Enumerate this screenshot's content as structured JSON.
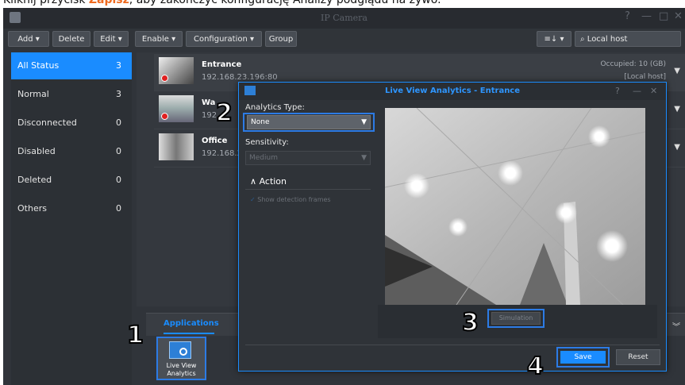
{
  "caption": {
    "prefix": "Kliknij przycisk ",
    "keyword": "Zapisz",
    "suffix": ", aby zakończyć konfigurację Analizy podglądu na żywo."
  },
  "window": {
    "title": "IP Camera",
    "help": "?",
    "minimize": "—",
    "maximize": "□",
    "close": "✕"
  },
  "toolbar": {
    "add": "Add ▾",
    "delete": "Delete",
    "edit": "Edit ▾",
    "enable": "Enable ▾",
    "configuration": "Configuration ▾",
    "group": "Group",
    "sort": "≡↓ ▾",
    "search_placeholder": "Local host"
  },
  "sidebar": {
    "items": [
      {
        "label": "All Status",
        "count": "3"
      },
      {
        "label": "Normal",
        "count": "3"
      },
      {
        "label": "Disconnected",
        "count": "0"
      },
      {
        "label": "Disabled",
        "count": "0"
      },
      {
        "label": "Deleted",
        "count": "0"
      },
      {
        "label": "Others",
        "count": "0"
      }
    ]
  },
  "cameras": [
    {
      "name": "Entrance",
      "ip": "192.168.23.196:80",
      "occupied": "Occupied: 10 (GB)",
      "host": "[Local host]"
    },
    {
      "name": "Wa",
      "ip": "192"
    },
    {
      "name": "Office",
      "ip": "192.168.2"
    }
  ],
  "applications": {
    "tab": "Applications",
    "tile_label": "Live View Analytics"
  },
  "dialog": {
    "title": "Live View Analytics - Entrance",
    "help": "?",
    "minimize": "—",
    "close": "✕",
    "analytics_type_label": "Analytics Type:",
    "analytics_type_value": "None",
    "sensitivity_label": "Sensitivity:",
    "sensitivity_value": "Medium",
    "action_label": "Action",
    "show_frames_label": "Show detection frames",
    "simulation": "Simulation",
    "save": "Save",
    "reset": "Reset"
  },
  "steps": [
    "1",
    "2",
    "3",
    "4"
  ],
  "colors": {
    "accent": "#1a8cff",
    "highlight": "#2c7be5",
    "caption_keyword": "#ef6a1f",
    "record_dot": "#e02020"
  }
}
